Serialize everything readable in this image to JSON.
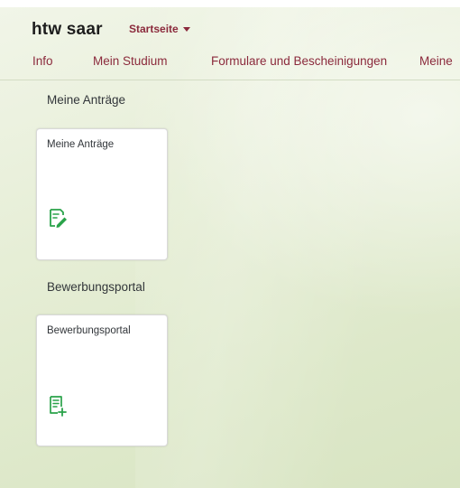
{
  "header": {
    "logo": "htw saar",
    "home_menu_label": "Startseite"
  },
  "tabs": [
    {
      "label": "Info"
    },
    {
      "label": "Mein Studium"
    },
    {
      "label": "Formulare und Bescheinigungen"
    },
    {
      "label": "Meine"
    }
  ],
  "groups": [
    {
      "title": "Meine Anträge",
      "tiles": [
        {
          "title": "Meine Anträge",
          "icon": "edit-form-icon"
        }
      ]
    },
    {
      "title": "Bewerbungsportal",
      "tiles": [
        {
          "title": "Bewerbungsportal",
          "icon": "add-document-icon"
        }
      ]
    }
  ],
  "colors": {
    "brand": "#8b2a3c",
    "icon_green": "#2aa34a",
    "text": "#32363a"
  }
}
